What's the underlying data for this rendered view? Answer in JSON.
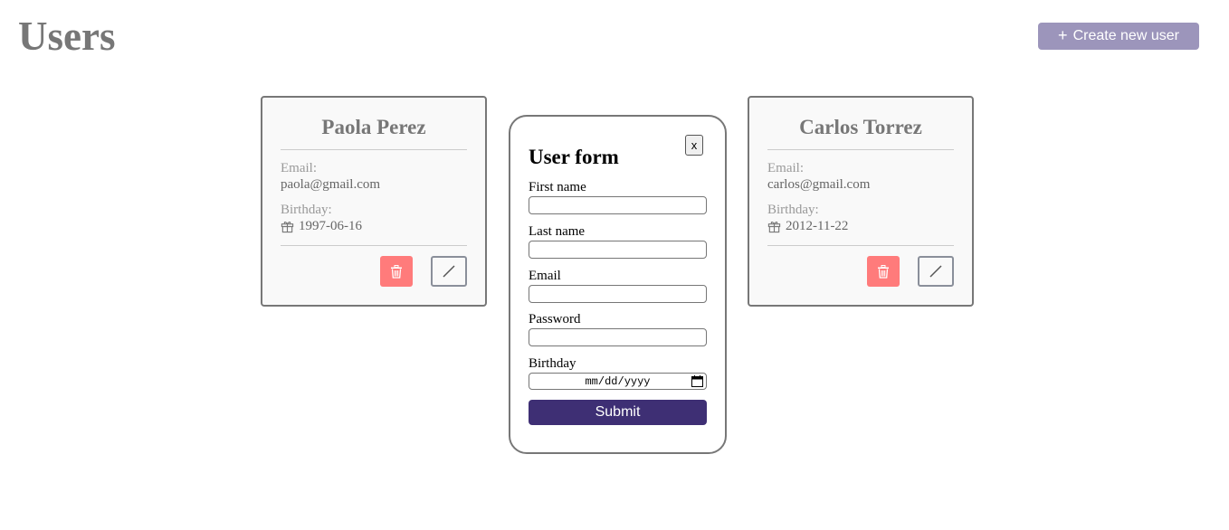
{
  "header": {
    "title": "Users",
    "create_button_label": "Create new user",
    "create_button_icon": "plus-icon"
  },
  "users": [
    {
      "name": "Paola Perez",
      "email_label": "Email:",
      "email": "paola@gmail.com",
      "birthday_label": "Birthday:",
      "birthday": "1997-06-16"
    },
    {
      "name": "Carlos Torrez",
      "email_label": "Email:",
      "email": "carlos@gmail.com",
      "birthday_label": "Birthday:",
      "birthday": "2012-11-22"
    }
  ],
  "form": {
    "title": "User form",
    "close_label": "x",
    "first_name_label": "First name",
    "last_name_label": "Last name",
    "email_label": "Email",
    "password_label": "Password",
    "birthday_label": "Birthday",
    "birthday_placeholder": "mm/dd/yyyy",
    "submit_label": "Submit"
  },
  "colors": {
    "accent": "#3e2f74",
    "create_button": "#9c95bb",
    "delete_button": "#ff7b7b"
  }
}
